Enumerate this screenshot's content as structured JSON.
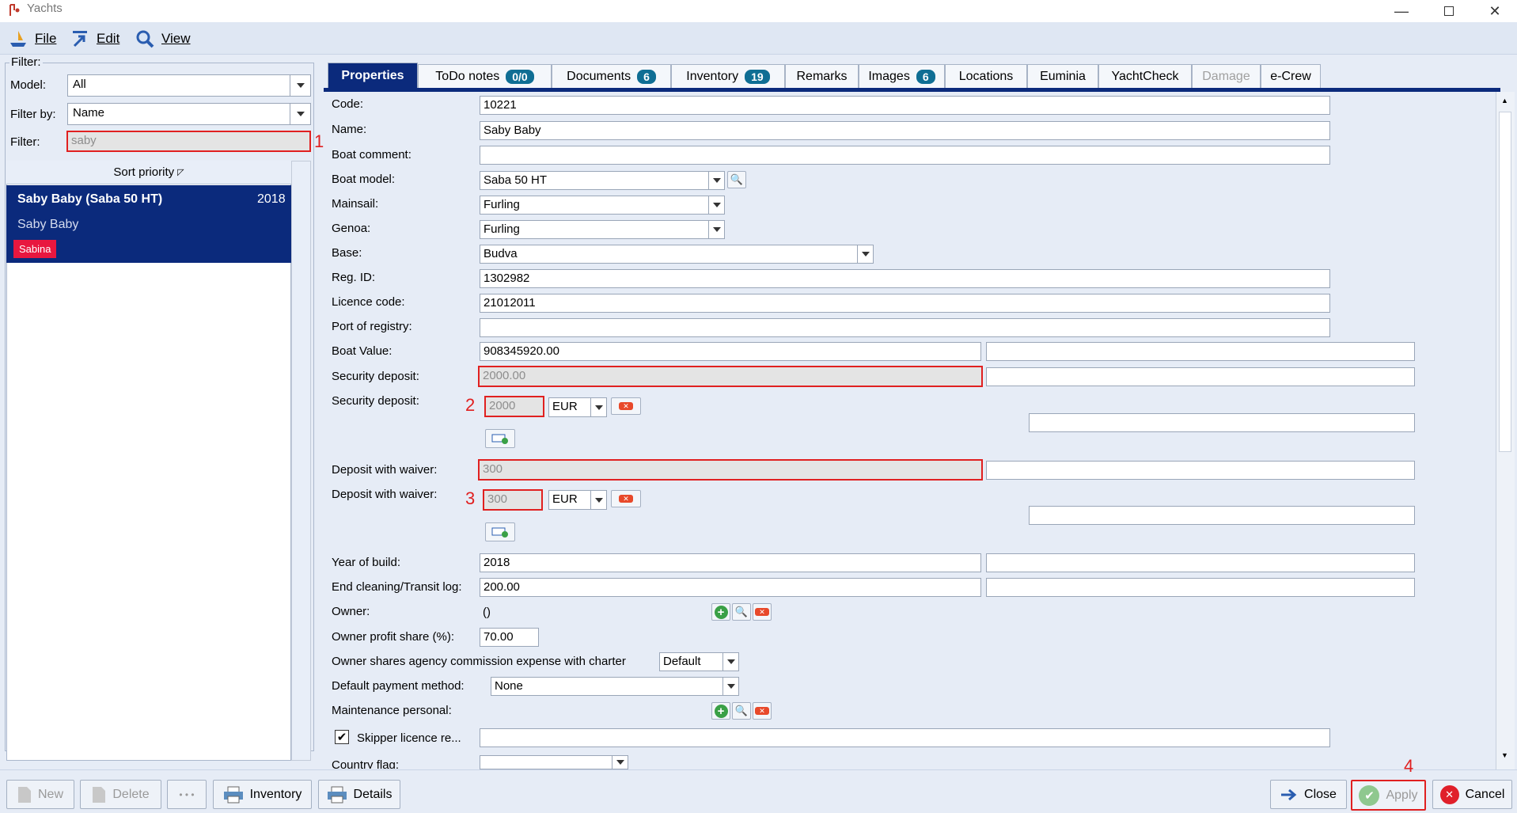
{
  "window": {
    "title": "Yachts"
  },
  "menu": {
    "file": "File",
    "edit": "Edit",
    "view": "View"
  },
  "filter": {
    "legend": "Filter:",
    "model_label": "Model:",
    "model_value": "All",
    "filter_by_label": "Filter by:",
    "filter_by_value": "Name",
    "filter_label": "Filter:",
    "filter_value": "saby",
    "marker": "1"
  },
  "list": {
    "header": "Sort priority",
    "items": [
      {
        "name": "Saby Baby (Saba 50 HT)",
        "year": "2018"
      },
      {
        "name": "Saby Baby"
      },
      {
        "name": "Sabina"
      }
    ]
  },
  "tabs": [
    {
      "label": "Properties"
    },
    {
      "label": "ToDo notes",
      "badge": "0/0"
    },
    {
      "label": "Documents",
      "badge": "6"
    },
    {
      "label": "Inventory",
      "badge": "19"
    },
    {
      "label": "Remarks"
    },
    {
      "label": "Images",
      "badge": "6"
    },
    {
      "label": "Locations"
    },
    {
      "label": "Euminia"
    },
    {
      "label": "YachtCheck"
    },
    {
      "label": "Damage"
    },
    {
      "label": "e-Crew"
    }
  ],
  "form": {
    "code": {
      "label": "Code:",
      "value": "10221"
    },
    "name": {
      "label": "Name:",
      "value": "Saby Baby"
    },
    "boat_comment": {
      "label": "Boat comment:",
      "value": ""
    },
    "boat_model": {
      "label": "Boat model:",
      "value": "Saba 50 HT"
    },
    "mainsail": {
      "label": "Mainsail:",
      "value": "Furling"
    },
    "genoa": {
      "label": "Genoa:",
      "value": "Furling"
    },
    "base": {
      "label": "Base:",
      "value": "Budva"
    },
    "reg_id": {
      "label": "Reg. ID:",
      "value": "1302982"
    },
    "licence_code": {
      "label": "Licence code:",
      "value": "21012011"
    },
    "port_of_registry": {
      "label": "Port of registry:",
      "value": ""
    },
    "boat_value": {
      "label": "Boat Value:",
      "value": "908345920.00"
    },
    "security_deposit": {
      "label": "Security deposit:",
      "value": "2000.00"
    },
    "security_deposit2": {
      "label": "Security deposit:",
      "value": "2000",
      "currency": "EUR",
      "marker": "2"
    },
    "deposit_waiver": {
      "label": "Deposit with waiver:",
      "value": "300"
    },
    "deposit_waiver2": {
      "label": "Deposit with waiver:",
      "value": "300",
      "currency": "EUR",
      "marker": "3"
    },
    "year_of_build": {
      "label": "Year of build:",
      "value": "2018"
    },
    "end_cleaning": {
      "label": "End cleaning/Transit log:",
      "value": "200.00"
    },
    "owner": {
      "label": "Owner:",
      "value": "()"
    },
    "owner_profit": {
      "label": "Owner profit share (%):",
      "value": "70.00"
    },
    "owner_shares": {
      "label": "Owner shares agency commission expense with charter",
      "value": "Default"
    },
    "payment_method": {
      "label": "Default payment method:",
      "value": "None"
    },
    "maintenance": {
      "label": "Maintenance personal:"
    },
    "skipper": {
      "label": "Skipper licence re...",
      "checked": true
    },
    "country_flag": {
      "label": "Country flag:"
    }
  },
  "bottom": {
    "new": "New",
    "delete": "Delete",
    "more": "• • •",
    "inventory": "Inventory",
    "details": "Details",
    "close": "Close",
    "apply": "Apply",
    "cancel": "Cancel",
    "marker": "4"
  },
  "colors": {
    "accent": "#0b2a7c",
    "highlight": "#e02020",
    "badge": "#0f6e94",
    "tag": "#e8173f"
  }
}
